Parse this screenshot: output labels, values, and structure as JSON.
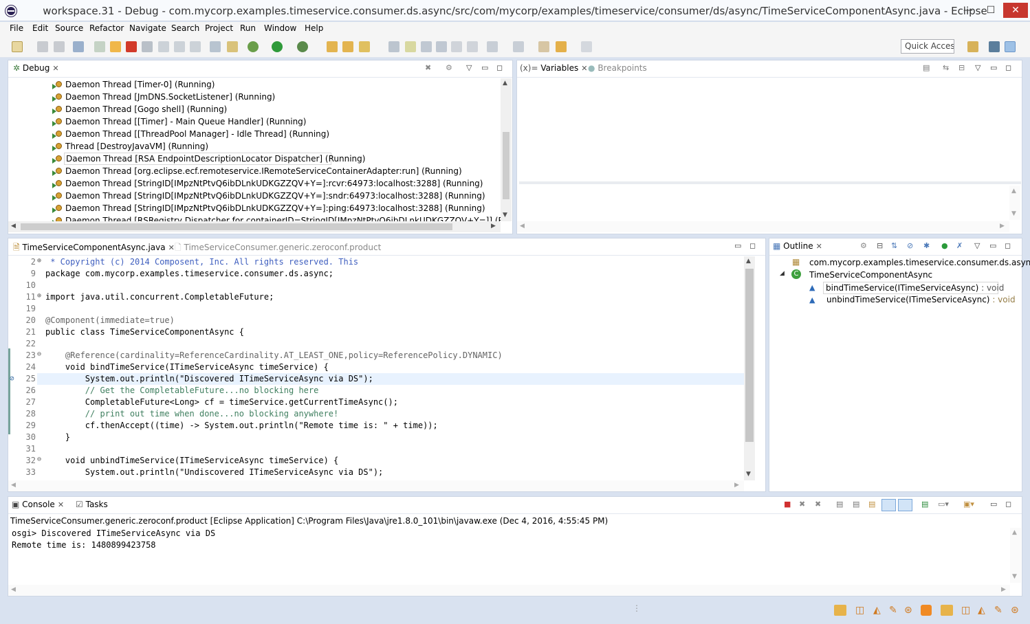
{
  "window": {
    "title": "workspace.31 - Debug - com.mycorp.examples.timeservice.consumer.ds.async/src/com/mycorp/examples/timeservice/consumer/ds/async/TimeServiceComponentAsync.java - Eclipse",
    "minimize": "—",
    "maximize": "☐",
    "close": "✕"
  },
  "menu": [
    "File",
    "Edit",
    "Source",
    "Refactor",
    "Navigate",
    "Search",
    "Project",
    "Run",
    "Window",
    "Help"
  ],
  "toolbar": {
    "quick_access": "Quick Access"
  },
  "debug_view": {
    "tab": "Debug",
    "threads": [
      "Daemon Thread [Timer-0] (Running)",
      "Daemon Thread [JmDNS.SocketListener] (Running)",
      "Daemon Thread [Gogo shell] (Running)",
      "Daemon Thread [[Timer] - Main Queue Handler] (Running)",
      "Daemon Thread [[ThreadPool Manager] - Idle Thread] (Running)",
      "Thread [DestroyJavaVM] (Running)",
      "Daemon Thread [RSA EndpointDescriptionLocator Dispatcher] (Running)",
      "Daemon Thread [org.eclipse.ecf.remoteservice.IRemoteServiceContainerAdapter:run] (Running)",
      "Daemon Thread [StringID[IMpzNtPtvQ6ibDLnkUDKGZZQV+Y=]:rcvr:64973:localhost:3288] (Running)",
      "Daemon Thread [StringID[IMpzNtPtvQ6ibDLnkUDKGZZQV+Y=]:sndr:64973:localhost:3288] (Running)",
      "Daemon Thread [StringID[IMpzNtPtvQ6ibDLnkUDKGZZQV+Y=]:ping:64973:localhost:3288] (Running)",
      "Daemon Thread [RSRegistry Dispatcher for containerID=StringID[IMpzNtPtvQ6ibDLnkUDKGZZQV+Y=]] (Running)"
    ]
  },
  "variables_view": {
    "tab_variables": "Variables",
    "tab_breakpoints": "Breakpoints",
    "prefix": "(x)="
  },
  "editor": {
    "tab_active": "TimeServiceComponentAsync.java",
    "tab_inactive": "TimeServiceConsumer.generic.zeroconf.product",
    "lines": [
      {
        "n": "2",
        "t": " * Copyright (c) 2014 Composent, Inc. All rights reserved. This"
      },
      {
        "n": "9",
        "t": "package com.mycorp.examples.timeservice.consumer.ds.async;"
      },
      {
        "n": "10",
        "t": ""
      },
      {
        "n": "11",
        "t": "import java.util.concurrent.CompletableFuture;"
      },
      {
        "n": "19",
        "t": ""
      },
      {
        "n": "20",
        "t": "@Component(immediate=true)"
      },
      {
        "n": "21",
        "t": "public class TimeServiceComponentAsync {"
      },
      {
        "n": "22",
        "t": ""
      },
      {
        "n": "23",
        "t": "    @Reference(cardinality=ReferenceCardinality.AT_LEAST_ONE,policy=ReferencePolicy.DYNAMIC)"
      },
      {
        "n": "24",
        "t": "    void bindTimeService(ITimeServiceAsync timeService) {"
      },
      {
        "n": "25",
        "t": "        System.out.println(\"Discovered ITimeServiceAsync via DS\");"
      },
      {
        "n": "26",
        "t": "        // Get the CompletableFuture...no blocking here"
      },
      {
        "n": "27",
        "t": "        CompletableFuture<Long> cf = timeService.getCurrentTimeAsync();"
      },
      {
        "n": "28",
        "t": "        // print out time when done...no blocking anywhere!"
      },
      {
        "n": "29",
        "t": "        cf.thenAccept((time) -> System.out.println(\"Remote time is: \" + time));"
      },
      {
        "n": "30",
        "t": "    }"
      },
      {
        "n": "31",
        "t": ""
      },
      {
        "n": "32",
        "t": "    void unbindTimeService(ITimeServiceAsync timeService) {"
      },
      {
        "n": "33",
        "t": "        System.out.println(\"Undiscovered ITimeServiceAsync via DS\");"
      }
    ]
  },
  "outline": {
    "tab": "Outline",
    "package": "com.mycorp.examples.timeservice.consumer.ds.async",
    "class": "TimeServiceComponentAsync",
    "methods": [
      {
        "name": "bindTimeService(ITimeServiceAsync)",
        "type": " : void"
      },
      {
        "name": "unbindTimeService(ITimeServiceAsync)",
        "type": " : void"
      }
    ]
  },
  "console": {
    "tab_console": "Console",
    "tab_tasks": "Tasks",
    "header": "TimeServiceConsumer.generic.zeroconf.product [Eclipse Application] C:\\Program Files\\Java\\jre1.8.0_101\\bin\\javaw.exe (Dec 4, 2016, 4:55:45 PM)",
    "lines": [
      "osgi> Discovered ITimeServiceAsync via DS",
      "Remote time is: 1480899423758"
    ]
  }
}
